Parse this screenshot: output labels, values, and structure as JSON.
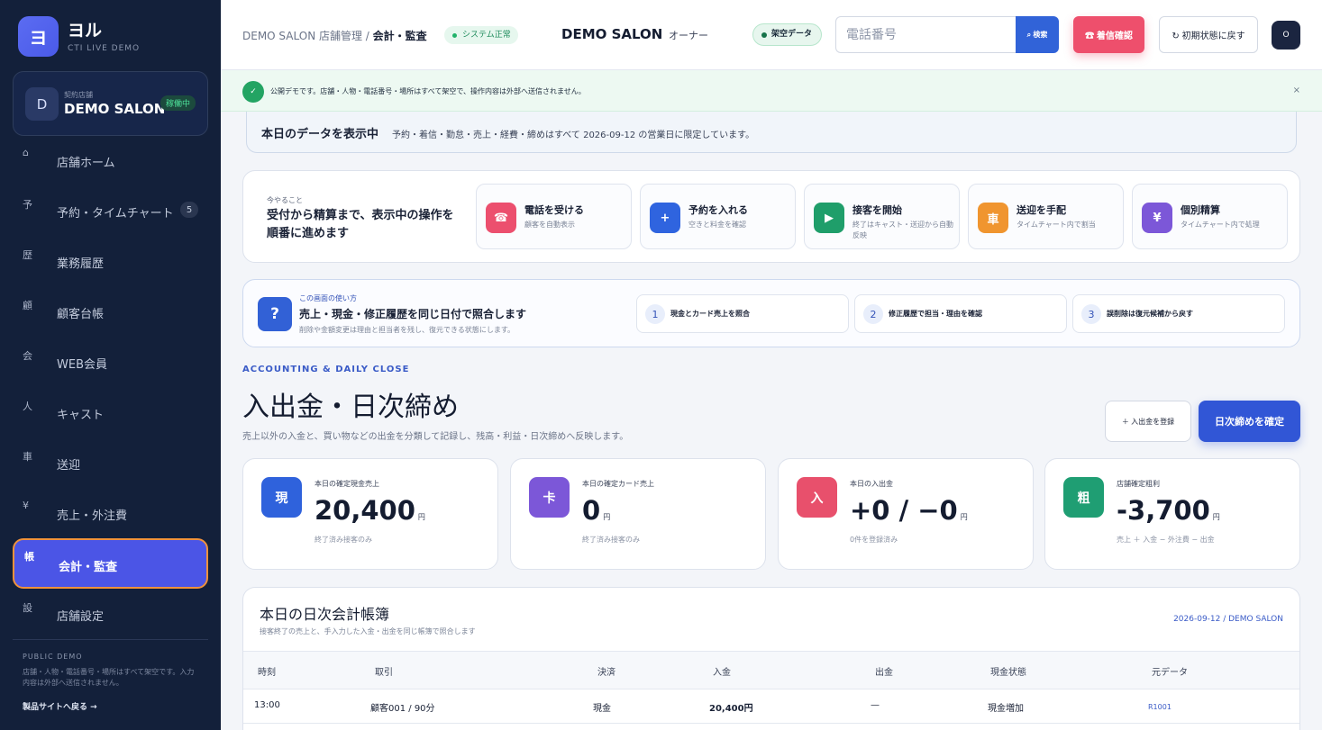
{
  "brand": {
    "logo": "ヨ",
    "name": "ヨル",
    "sub": "CTI LIVE DEMO"
  },
  "store": {
    "avatar": "D",
    "label": "契約店舗",
    "name": "DEMO SALON",
    "status": "稼働中"
  },
  "nav": [
    {
      "icon": "⌂",
      "label": "店舗ホーム"
    },
    {
      "icon": "予",
      "label": "予約・タイムチャート",
      "count": "5"
    },
    {
      "icon": "歴",
      "label": "業務履歴"
    },
    {
      "icon": "顧",
      "label": "顧客台帳"
    },
    {
      "icon": "会",
      "label": "WEB会員"
    },
    {
      "icon": "人",
      "label": "キャスト"
    },
    {
      "icon": "車",
      "label": "送迎"
    },
    {
      "icon": "¥",
      "label": "売上・外注費"
    },
    {
      "icon": "帳",
      "label": "会計・監査"
    },
    {
      "icon": "設",
      "label": "店舗設定"
    }
  ],
  "sidebar_footer": {
    "title": "PUBLIC DEMO",
    "note": "店舗・人物・電話番号・場所はすべて架空です。入力内容は外部へ送信されません。",
    "back_link": "製品サイトへ戻る →"
  },
  "header": {
    "crumb_prefix": "DEMO SALON 店舗管理 / ",
    "crumb_current": "会計・監査",
    "system_status": "システム正常",
    "store_name": "DEMO SALON",
    "role": "オーナー",
    "fake_badge": "架空データ",
    "phone_placeholder": "電話番号",
    "search_label": "⌕ 検索",
    "incoming_label": "☎ 着信確認",
    "reset_label": "↻ 初期状態に戻す",
    "user_initial": "O"
  },
  "notice": {
    "check": "✓",
    "text": "公開デモです。店舗・人物・電話番号・場所はすべて架空で、操作内容は外部へ送信されません。",
    "close": "×"
  },
  "today": {
    "title": "本日のデータを表示中",
    "desc": "予約・着信・勤怠・売上・経費・締めはすべて 2026-09-12 の営業日に限定しています。"
  },
  "todo": {
    "eyebrow": "今やること",
    "title": "受付から精算まで、表示中の操作を順番に進めます",
    "steps": [
      {
        "icon": "☎",
        "title": "電話を受ける",
        "sub": "顧客を自動表示",
        "color": "#ec4f6e"
      },
      {
        "icon": "+",
        "title": "予約を入れる",
        "sub": "空きと料金を確認",
        "color": "#2f64df"
      },
      {
        "icon": "▶",
        "title": "接客を開始",
        "sub": "終了はキャスト・送迎から自動反映",
        "color": "#1f9e6a"
      },
      {
        "icon": "車",
        "title": "送迎を手配",
        "sub": "タイムチャート内で割当",
        "color": "#f0952f"
      },
      {
        "icon": "¥",
        "title": "個別精算",
        "sub": "タイムチャート内で処理",
        "color": "#7c57d8"
      }
    ]
  },
  "help": {
    "icon": "?",
    "eyebrow": "この画面の使い方",
    "title": "売上・現金・修正履歴を同じ日付で照合します",
    "sub": "削除や金額変更は理由と担当者を残し、復元できる状態にします。",
    "steps": [
      {
        "num": "1",
        "label": "現金とカード売上を照合"
      },
      {
        "num": "2",
        "label": "修正履歴で担当・理由を確認"
      },
      {
        "num": "3",
        "label": "誤削除は復元候補から戻す"
      }
    ]
  },
  "page": {
    "eyebrow": "ACCOUNTING & DAILY CLOSE",
    "title": "入出金・日次締め",
    "sub": "売上以外の入金と、買い物などの出金を分類して記録し、残高・利益・日次締めへ反映します。",
    "register_label": "＋ 入出金を登録",
    "close_label": "日次締めを確定"
  },
  "stats": [
    {
      "icon": "現",
      "label": "本日の確定現金売上",
      "value": "20,400",
      "unit": "円",
      "note": "終了済み接客のみ",
      "color": "#2f62dc"
    },
    {
      "icon": "卡",
      "label": "本日の確定カード売上",
      "value": "0",
      "unit": "円",
      "note": "終了済み接客のみ",
      "color": "#7c57d8"
    },
    {
      "icon": "入",
      "label": "本日の入出金",
      "value": "+0 / −0",
      "unit": "円",
      "note": "0件を登録済み",
      "color": "#e8506c"
    },
    {
      "icon": "粗",
      "label": "店舗確定粗利",
      "value": "-3,700",
      "unit": "円",
      "note": "売上 ＋ 入金 − 外注費 − 出金",
      "color": "#1f9e73"
    }
  ],
  "ledger": {
    "title": "本日の日次会計帳簿",
    "sub": "接客終了の売上と、手入力した入金・出金を同じ帳簿で照合します",
    "meta": "2026-09-12 / DEMO SALON",
    "headers": [
      "時刻",
      "取引",
      "決済",
      "入金",
      "出金",
      "現金状態",
      "元データ"
    ],
    "rows": [
      [
        "13:00",
        "顧客001 / 90分",
        "現金",
        "20,400円",
        "—",
        "現金増加",
        "R1001"
      ]
    ]
  }
}
